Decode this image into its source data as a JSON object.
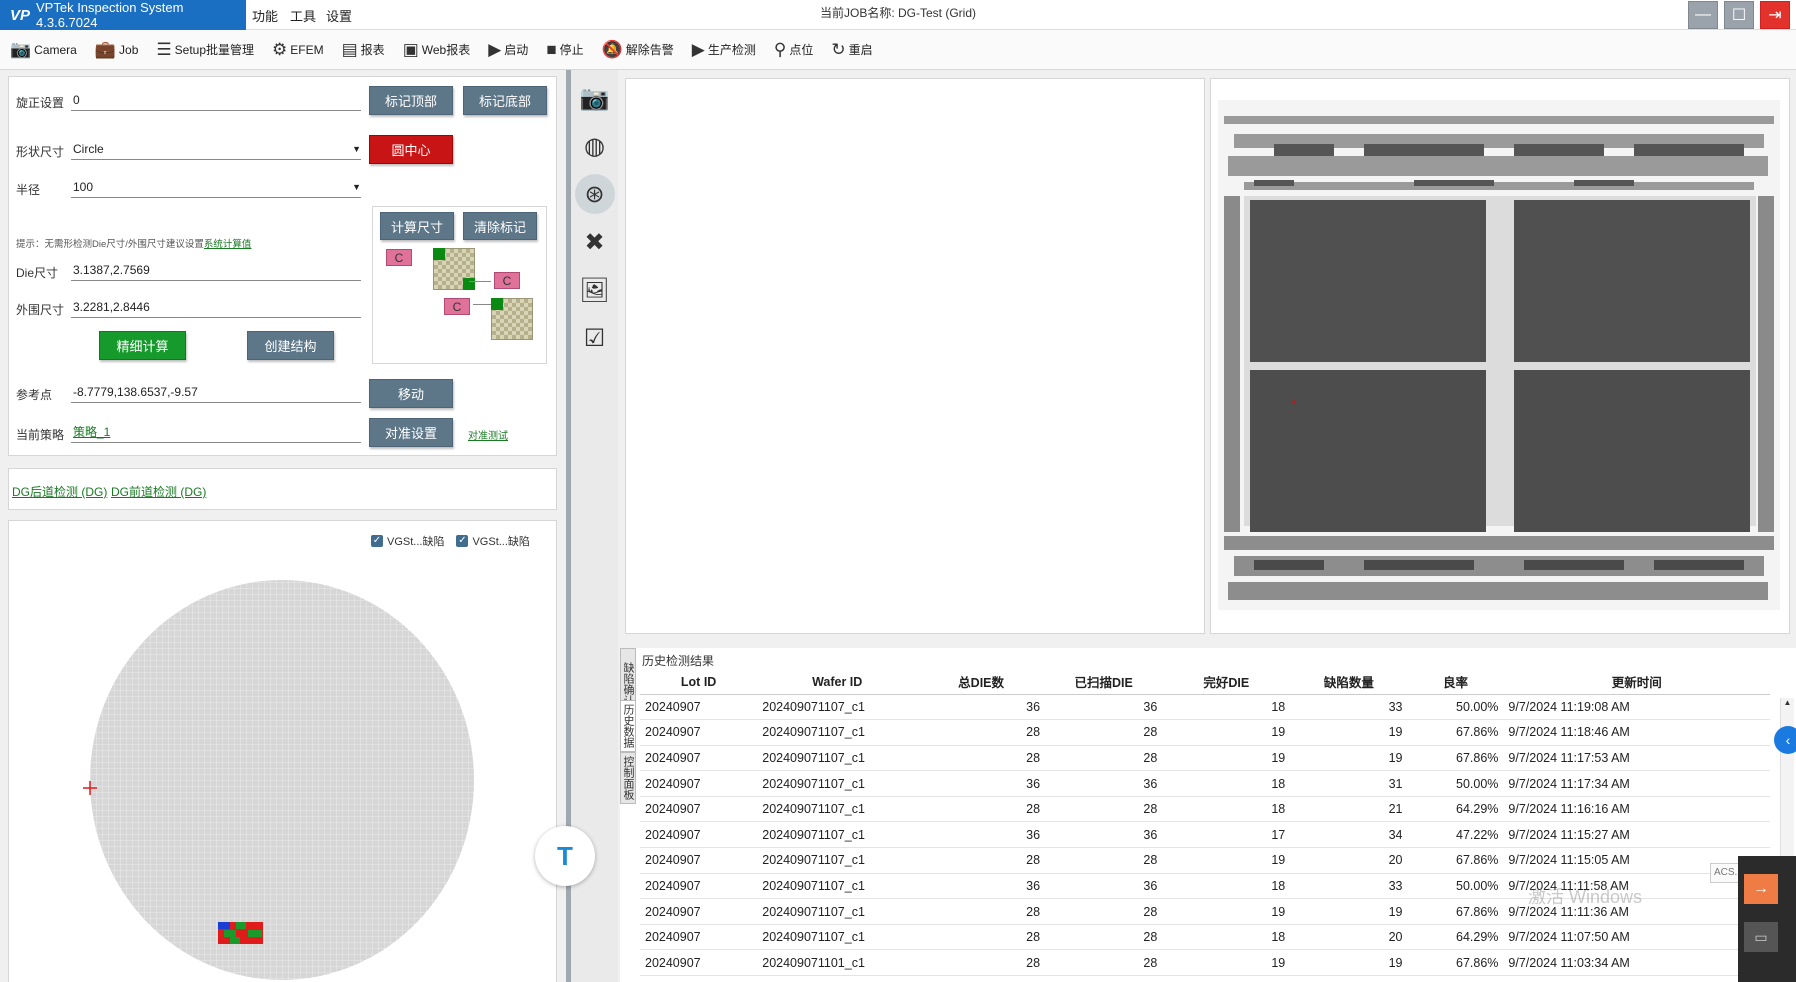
{
  "app": {
    "logo": "VP",
    "title": "VPTek Inspection System 4.3.6.7024",
    "job_title": "当前JOB名称: DG-Test (Grid)"
  },
  "menu": [
    "功能",
    "工具",
    "设置"
  ],
  "window_buttons": {
    "minimize": "—",
    "maximize": "☐",
    "close": "⇥"
  },
  "toolbar": [
    {
      "label": "Camera",
      "icon": "📷"
    },
    {
      "label": "Job",
      "icon": "💼"
    },
    {
      "label": "Setup批量管理",
      "icon": "☰"
    },
    {
      "label": "EFEM",
      "icon": "⚙"
    },
    {
      "label": "报表",
      "icon": "▤"
    },
    {
      "label": "Web报表",
      "icon": "▣"
    },
    {
      "label": "启动",
      "icon": "▶"
    },
    {
      "label": "停止",
      "icon": "■"
    },
    {
      "label": "解除告警",
      "icon": "🔕"
    },
    {
      "label": "生产检测",
      "icon": "▶"
    },
    {
      "label": "点位",
      "icon": "⚲"
    },
    {
      "label": "重启",
      "icon": "↻"
    }
  ],
  "setup": {
    "rotation_label": "旋正设置",
    "rotation_value": "0",
    "shape_label": "形状尺寸",
    "shape_value": "Circle",
    "radius_label": "半径",
    "radius_value": "100",
    "hint": "提示：无需形检测Die尺寸/外围尺寸建议设置",
    "hint_link": "系统计算值",
    "die_label": "Die尺寸",
    "die_value": "3.1387,2.7569",
    "outer_label": "外围尺寸",
    "outer_value": "3.2281,2.8446",
    "ref_label": "参考点",
    "ref_value": "-8.7779,138.6537,-9.57",
    "strategy_label": "当前策略",
    "strategy_value": "策略_1",
    "btn_mark_top": "标记顶部",
    "btn_mark_bottom": "标记底部",
    "btn_circle_center": "圆中心",
    "btn_calc": "计算尺寸",
    "btn_clear": "清除标记",
    "btn_fine": "精细计算",
    "btn_create": "创建结构",
    "btn_move": "移动",
    "btn_align": "对准设置",
    "align_test_link": "对准测试",
    "diagram_label": "C"
  },
  "dg_links": [
    "DG后道检测 (DG)",
    "DG前道检测 (DG)"
  ],
  "wafer": {
    "checks": [
      "VGSt...缺陷",
      "VGSt...缺陷"
    ]
  },
  "results": {
    "title": "历史检测结果",
    "side_tabs": [
      "缺陷确认",
      "历史数据",
      "控制面板"
    ],
    "columns": [
      "Lot ID",
      "Wafer ID",
      "总DIE数",
      "已扫描DIE",
      "完好DIE",
      "缺陷数量",
      "良率",
      "更新时间"
    ],
    "rows": [
      [
        "20240907",
        "202409071107_c1",
        "36",
        "36",
        "18",
        "33",
        "50.00%",
        "9/7/2024 11:19:08 AM"
      ],
      [
        "20240907",
        "202409071107_c1",
        "28",
        "28",
        "19",
        "19",
        "67.86%",
        "9/7/2024 11:18:46 AM"
      ],
      [
        "20240907",
        "202409071107_c1",
        "28",
        "28",
        "19",
        "19",
        "67.86%",
        "9/7/2024 11:17:53 AM"
      ],
      [
        "20240907",
        "202409071107_c1",
        "36",
        "36",
        "18",
        "31",
        "50.00%",
        "9/7/2024 11:17:34 AM"
      ],
      [
        "20240907",
        "202409071107_c1",
        "28",
        "28",
        "18",
        "21",
        "64.29%",
        "9/7/2024 11:16:16 AM"
      ],
      [
        "20240907",
        "202409071107_c1",
        "36",
        "36",
        "17",
        "34",
        "47.22%",
        "9/7/2024 11:15:27 AM"
      ],
      [
        "20240907",
        "202409071107_c1",
        "28",
        "28",
        "19",
        "20",
        "67.86%",
        "9/7/2024 11:15:05 AM"
      ],
      [
        "20240907",
        "202409071107_c1",
        "36",
        "36",
        "18",
        "33",
        "50.00%",
        "9/7/2024 11:11:58 AM"
      ],
      [
        "20240907",
        "202409071107_c1",
        "28",
        "28",
        "19",
        "19",
        "67.86%",
        "9/7/2024 11:11:36 AM"
      ],
      [
        "20240907",
        "202409071107_c1",
        "28",
        "28",
        "18",
        "20",
        "64.29%",
        "9/7/2024 11:07:50 AM"
      ],
      [
        "20240907",
        "202409071101_c1",
        "28",
        "28",
        "19",
        "19",
        "67.86%",
        "9/7/2024 11:03:34 AM"
      ]
    ]
  },
  "overlay": {
    "acs": "ACS.",
    "watermark": "激活 Windows"
  },
  "colors": {
    "brand": "#1b6fc2",
    "button": "#5d7789",
    "danger": "#c81414",
    "success": "#159a2b",
    "link": "#1a7a24"
  }
}
